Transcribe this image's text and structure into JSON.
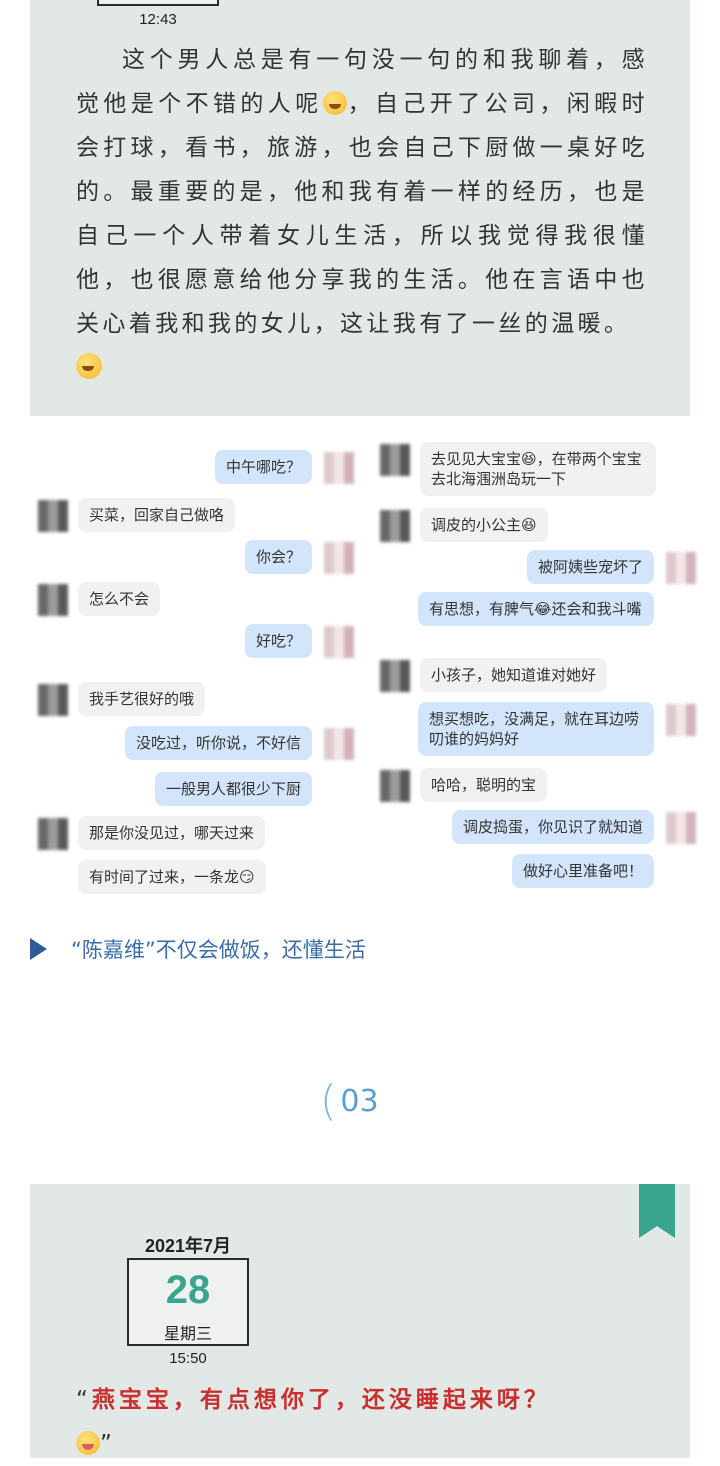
{
  "top_card": {
    "time": "12:43",
    "story_text": "这个男人总是有一句没一句的和我聊着，感觉他是个不错的人呢",
    "story_text_2": "，自己开了公司，闲暇时会打球，看书，旅游，也会自己下厨做一桌好吃的。最重要的是，他和我有着一样的经历，也是自己一个人带着女儿生活，所以我觉得我很懂他，也很愿意给他分享我的生活。他在言语中也关心着我和我的女儿，这让我有了一丝的温暖。",
    "emoji_1": "grinning-emoji",
    "emoji_2": "smiling-emoji"
  },
  "chat_left": [
    {
      "side": "me",
      "text": "中午哪吃？"
    },
    {
      "side": "them",
      "text": "买菜，回家自己做咯"
    },
    {
      "side": "me",
      "text": "你会？"
    },
    {
      "side": "them",
      "text": "怎么不会"
    },
    {
      "side": "me",
      "text": "好吃？"
    },
    {
      "side": "them",
      "text": "我手艺很好的哦"
    },
    {
      "side": "me",
      "text": "没吃过，听你说，不好信"
    },
    {
      "side": "me",
      "text": "一般男人都很少下厨"
    },
    {
      "side": "them",
      "text": "那是你没见过，哪天过来"
    },
    {
      "side": "them",
      "text": "有时间了过来，一条龙😏"
    }
  ],
  "chat_right": [
    {
      "side": "them",
      "text": "去见见大宝宝😆，在带两个宝宝去北海涠洲岛玩一下"
    },
    {
      "side": "them",
      "text": "调皮的小公主😆"
    },
    {
      "side": "me",
      "text": "被阿姨些宠坏了"
    },
    {
      "side": "me",
      "text": "有思想，有脾气😂还会和我斗嘴"
    },
    {
      "side": "them",
      "text": "小孩子，她知道谁对她好"
    },
    {
      "side": "me",
      "text": "想买想吃，没满足，就在耳边唠叨谁的妈妈好"
    },
    {
      "side": "them",
      "text": "哈哈，聪明的宝"
    },
    {
      "side": "me",
      "text": "调皮捣蛋，你见识了就知道"
    },
    {
      "side": "me",
      "text": "做好心里准备吧！"
    }
  ],
  "caption": "“陈嘉维”不仅会做饭，还懂生活",
  "section_number": "03",
  "bottom_card": {
    "month": "2021年7月",
    "day": "28",
    "weekday": "星期三",
    "time": "15:50",
    "quote_open": "“",
    "quote_text": "燕宝宝，有点想你了，还没睡起来呀？",
    "quote_close": "”",
    "emoji": "tongue-emoji"
  },
  "colors": {
    "panel_bg": "#e2e8e5",
    "accent_green": "#3aa58e",
    "caption_blue": "#3b6ea8",
    "quote_red": "#c92f2f",
    "bubble_me": "#d3e5fb",
    "bubble_them": "#f1f1f1"
  }
}
